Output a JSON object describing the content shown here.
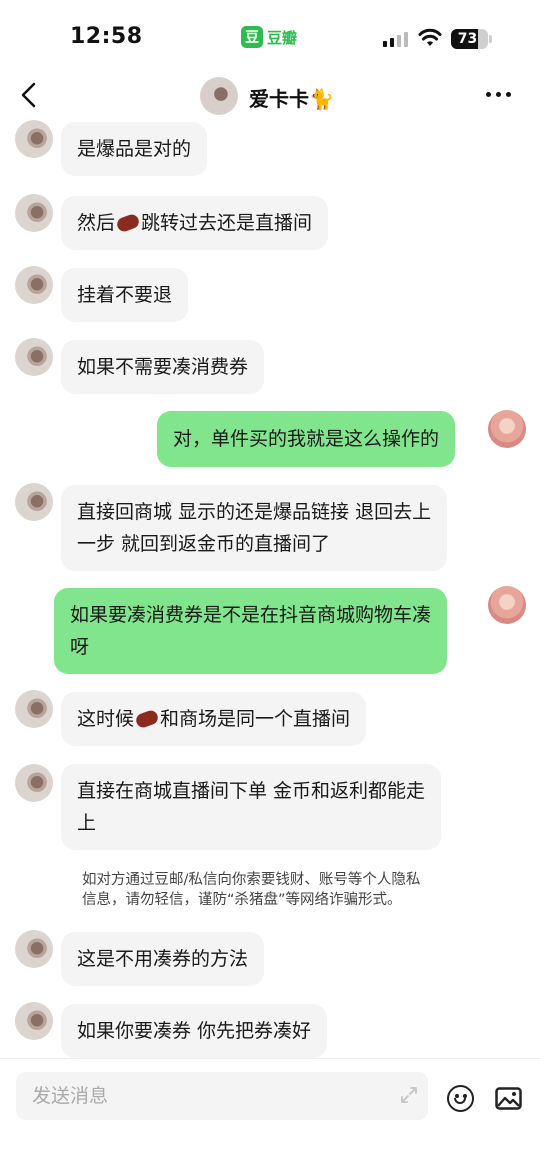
{
  "status_bar": {
    "time": "12:58",
    "app_logo": "豆",
    "app_name": "豆瓣",
    "battery": "73",
    "battery_level": 0.73
  },
  "header": {
    "name": "爱卡卡🐈",
    "back_icon": "chevron-left-icon",
    "more_icon": "more-dots-icon"
  },
  "messages": [
    {
      "from": "other",
      "text": "是爆品是对的"
    },
    {
      "from": "other",
      "parts": [
        "然后",
        "跳转过去还是直播间"
      ]
    },
    {
      "from": "other",
      "text": "挂着不要退"
    },
    {
      "from": "other",
      "text": "如果不需要凑消费券"
    },
    {
      "from": "me",
      "text": "对，单件买的我就是这么操作的"
    },
    {
      "from": "other",
      "lines": [
        "直接回商城 显示的还是爆品链接 退回去上",
        "一步 就回到返金币的直播间了"
      ]
    },
    {
      "from": "me",
      "lines": [
        "如果要凑消费券是不是在抖音商城购物车凑",
        "呀"
      ]
    },
    {
      "from": "other",
      "parts": [
        "这时候",
        "和商场是同一个直播间"
      ]
    },
    {
      "from": "other",
      "lines": [
        "直接在商城直播间下单 金币和返利都能走",
        "上"
      ]
    },
    {
      "from": "other",
      "text": "这是不用凑券的方法"
    },
    {
      "from": "other",
      "text": "如果你要凑券 你先把券凑好"
    }
  ],
  "notice": {
    "line1": "如对方通过豆邮/私信向你索要钱财、账号等个人隐私",
    "line2": "信息，请勿轻信，谨防“杀猪盘”等网络诈骗形式。"
  },
  "input": {
    "placeholder": "发送消息"
  }
}
